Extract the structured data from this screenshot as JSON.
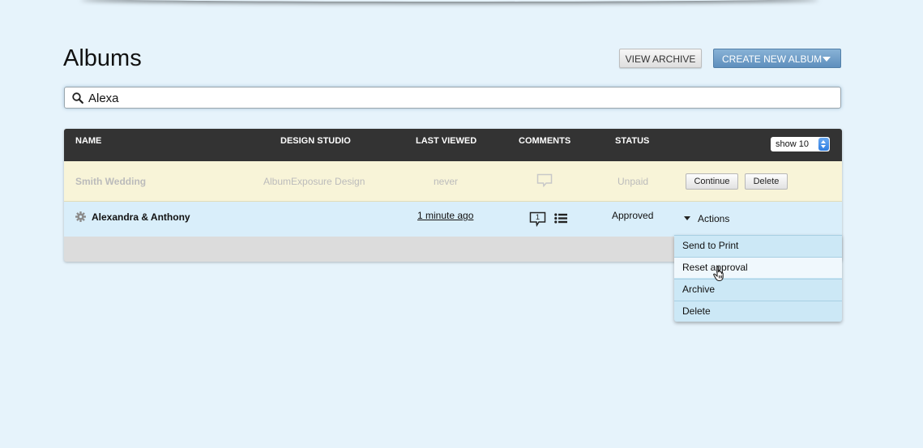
{
  "header": {
    "title": "Albums",
    "view_archive_label": "VIEW ARCHIVE",
    "create_album_label": "CREATE NEW ALBUM"
  },
  "search": {
    "value": "Alexa",
    "icon": "search-icon"
  },
  "table": {
    "columns": [
      "NAME",
      "DESIGN STUDIO",
      "LAST VIEWED",
      "COMMENTS",
      "STATUS"
    ],
    "page_size_label": "show 10",
    "rows": [
      {
        "name": "Smith Wedding",
        "design_studio": "AlbumExposure Design",
        "last_viewed": "never",
        "comments_icon": "comment-icon",
        "status": "Unpaid",
        "continue_label": "Continue",
        "delete_label": "Delete"
      },
      {
        "name": "Alexandra & Anthony",
        "design_studio": "",
        "last_viewed": "1 minute ago",
        "comments_count": "1",
        "comments_icon": "comment-icon",
        "list_icon": "list-icon",
        "status": "Approved",
        "actions_label": "Actions"
      }
    ]
  },
  "actions_menu": {
    "items": [
      "Send to Print",
      "Reset approval",
      "Archive",
      "Delete"
    ]
  },
  "colors": {
    "background": "#e6f3fb",
    "header_bar": "#333333",
    "accent_button": "#6f9dc8",
    "pending_row": "#f8f4d8",
    "active_row": "#d9eefa"
  }
}
